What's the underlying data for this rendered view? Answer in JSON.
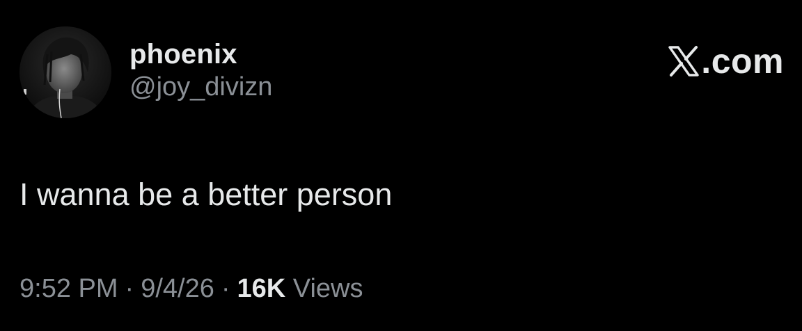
{
  "tweet": {
    "author": {
      "display_name": "phoenix",
      "handle": "@joy_divizn",
      "avatar_icon": "profile-photo"
    },
    "brand": {
      "logo_icon": "x-logo-icon",
      "text": ".com"
    },
    "text": "I wanna be a better person",
    "meta": {
      "time": "9:52 PM",
      "separator": "·",
      "date": "9/4/26",
      "views_count": "16K",
      "views_label": "Views"
    }
  },
  "colors": {
    "background": "#000000",
    "primary_text": "#e7e9ea",
    "secondary_text": "#8b9096"
  }
}
